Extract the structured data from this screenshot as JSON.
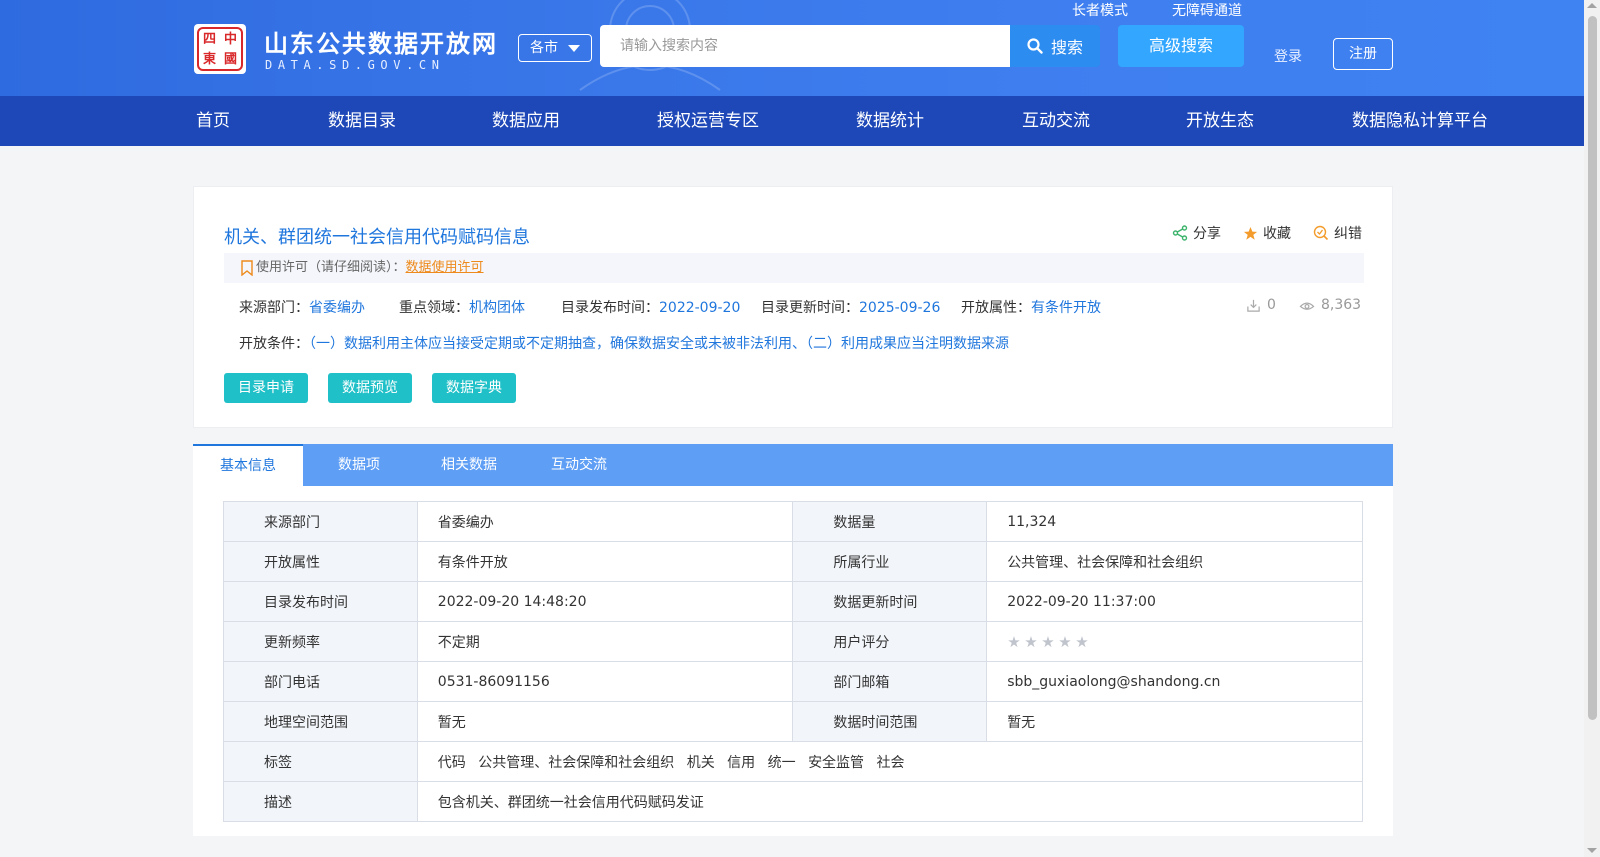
{
  "header": {
    "logo_chars": [
      "中",
      "四",
      "國",
      "東"
    ],
    "site_title": "山东公共数据开放网",
    "site_sub": "DATA.SD.GOV.CN",
    "city": "各市",
    "search_placeholder": "请输入搜索内容",
    "search_label": "搜索",
    "advanced_search": "高级搜索",
    "elder_mode": "长者模式",
    "accessibility": "无障碍通道",
    "login": "登录",
    "register": "注册"
  },
  "nav": [
    "首页",
    "数据目录",
    "数据应用",
    "授权运营专区",
    "数据统计",
    "互动交流",
    "开放生态",
    "数据隐私计算平台"
  ],
  "dataset": {
    "title": "机关、群团统一社会信用代码赋码信息",
    "actions": {
      "share": "分享",
      "favorite": "收藏",
      "correct": "纠错"
    },
    "license_label": "使用许可（请仔细阅读）：",
    "license_link": "数据使用许可",
    "meta": {
      "source_label": "来源部门：",
      "source": "省委编办",
      "domain_label": "重点领域：",
      "domain": "机构团体",
      "publish_label": "目录发布时间：",
      "publish": "2022-09-20",
      "update_label": "目录更新时间：",
      "update": "2025-09-26",
      "open_label": "开放属性：",
      "open": "有条件开放",
      "downloads": "0",
      "views": "8,363"
    },
    "condition_label": "开放条件：",
    "condition": "（一）数据利用主体应当接受定期或不定期抽查，确保数据安全或未被非法利用、（二）利用成果应当注明数据来源",
    "buttons": [
      "目录申请",
      "数据预览",
      "数据字典"
    ]
  },
  "tabs": [
    "基本信息",
    "数据项",
    "相关数据",
    "互动交流"
  ],
  "info": {
    "r1": {
      "k1": "来源部门",
      "v1": "省委编办",
      "k2": "数据量",
      "v2": "11,324"
    },
    "r2": {
      "k1": "开放属性",
      "v1": "有条件开放",
      "k2": "所属行业",
      "v2": "公共管理、社会保障和社会组织"
    },
    "r3": {
      "k1": "目录发布时间",
      "v1": "2022-09-20 14:48:20",
      "k2": "数据更新时间",
      "v2": "2022-09-20 11:37:00"
    },
    "r4": {
      "k1": "更新频率",
      "v1": "不定期",
      "k2": "用户评分",
      "rating": 0
    },
    "r5": {
      "k1": "部门电话",
      "v1": "0531-86091156",
      "k2": "部门邮箱",
      "v2": "sbb_guxiaolong@shandong.cn"
    },
    "r6": {
      "k1": "地理空间范围",
      "v1": "暂无",
      "k2": "数据时间范围",
      "v2": "暂无"
    },
    "tags_label": "标签",
    "tags": [
      "代码",
      "公共管理、社会保障和社会组织",
      "机关",
      "信用",
      "统一",
      "安全监管",
      "社会"
    ],
    "desc_label": "描述",
    "desc": "包含机关、群团统一社会信用代码赋码发证"
  },
  "colors": {
    "header": "#3a78ea",
    "nav": "#1e48b8",
    "link": "#1f76dd",
    "button": "#1fc0c8",
    "tab_bar": "#5e9ef5",
    "license_link": "#ee8a1c"
  }
}
